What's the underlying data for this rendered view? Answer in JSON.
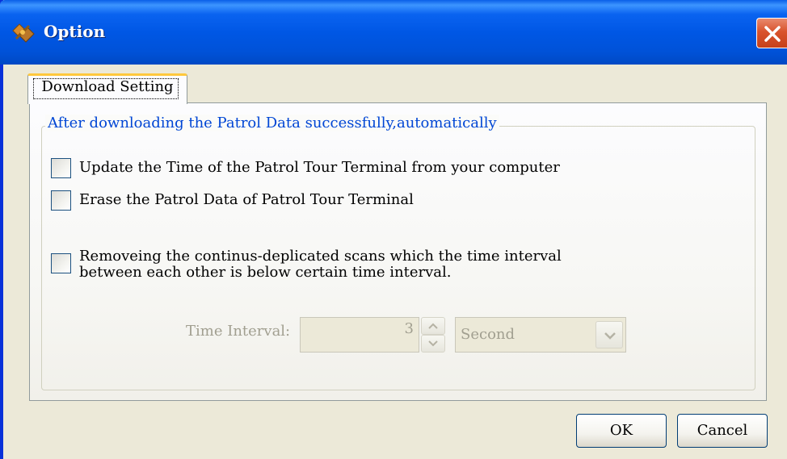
{
  "window": {
    "title": "Option",
    "icon": "app-icon",
    "close_icon": "close-icon"
  },
  "tabs": [
    {
      "label": "Download Setting",
      "selected": true
    }
  ],
  "group": {
    "legend": "After downloading the Patrol Data successfully,automatically"
  },
  "options": {
    "update_time": {
      "label": "Update the Time of the Patrol Tour Terminal from your computer",
      "checked": false
    },
    "erase_data": {
      "label": "Erase the Patrol Data of Patrol Tour Terminal",
      "checked": false
    },
    "remove_duplicates": {
      "label_line1": "Removeing the continus-deplicated scans which the time interval",
      "label_line2": "between each other is below certain time interval.",
      "checked": false
    }
  },
  "time_interval": {
    "label": "Time Interval:",
    "value": "3",
    "unit": "Second",
    "enabled": false
  },
  "buttons": {
    "ok": "OK",
    "cancel": "Cancel"
  },
  "colors": {
    "titlebar": "#0055e5",
    "legend_text": "#0046d5",
    "disabled_text": "#a19f90",
    "window_bg": "#ece9d8"
  }
}
